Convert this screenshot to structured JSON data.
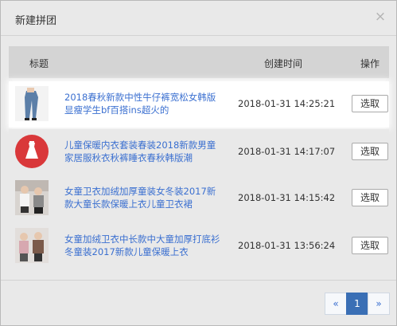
{
  "dialog": {
    "title": "新建拼团",
    "close_glyph": "×"
  },
  "table": {
    "headers": {
      "title": "标题",
      "time": "创建时间",
      "op": "操作"
    },
    "rows": [
      {
        "title": "2018春秋新款中性牛仔裤宽松女韩版显瘦学生bf百搭ins超火的",
        "time": "2018-01-31 14:25:21",
        "action": "选取",
        "thumb": "jeans-photo"
      },
      {
        "title": "儿童保暖内衣套装春装2018新款男童家居服秋衣秋裤睡衣春秋韩版潮",
        "time": "2018-01-31 14:17:07",
        "action": "选取",
        "thumb": "dress-icon"
      },
      {
        "title": "女童卫衣加绒加厚童装女冬装2017新款大童长款保暖上衣儿童卫衣裙",
        "time": "2018-01-31 14:15:42",
        "action": "选取",
        "thumb": "kids-photo"
      },
      {
        "title": "女童加绒卫衣中长款中大童加厚打底衫冬童装2017新款儿童保暖上衣",
        "time": "2018-01-31 13:56:24",
        "action": "选取",
        "thumb": "kids-photo-2"
      }
    ]
  },
  "pagination": {
    "prev": "«",
    "current": "1",
    "next": "»"
  },
  "colors": {
    "link": "#3a6fd0",
    "accent_red": "#d9383a",
    "pager_active": "#3a6fb5"
  }
}
